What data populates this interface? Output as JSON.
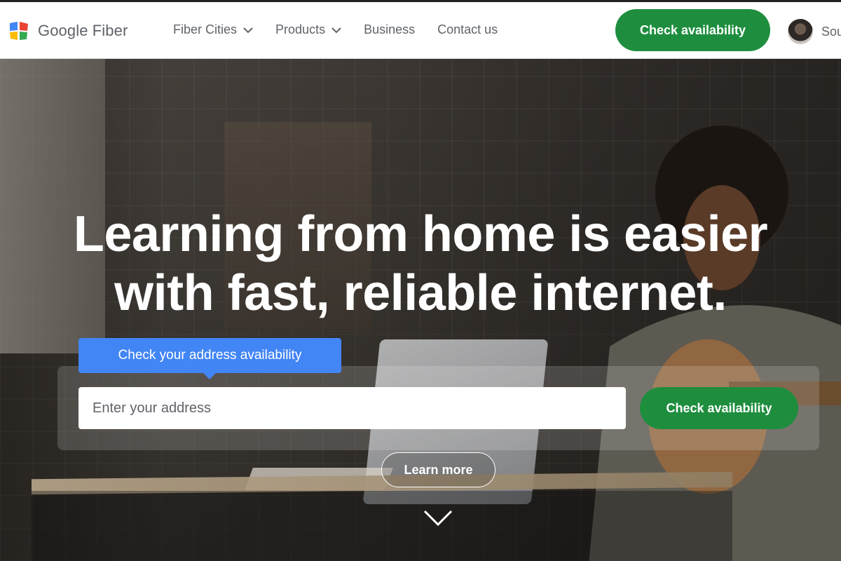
{
  "header": {
    "brand": "Google Fiber",
    "nav": [
      {
        "label": "Fiber Cities",
        "has_dropdown": true
      },
      {
        "label": "Products",
        "has_dropdown": true
      },
      {
        "label": "Business",
        "has_dropdown": false
      },
      {
        "label": "Contact us",
        "has_dropdown": false
      }
    ],
    "cta_label": "Check availability",
    "account_label": "Sou"
  },
  "hero": {
    "headline_line1": "Learning from home is easier",
    "headline_line2": "with fast, reliable internet.",
    "tooltip": "Check your address availability",
    "address_placeholder": "Enter your address",
    "address_value": "",
    "cta_label": "Check availability",
    "learn_more_label": "Learn more"
  },
  "icons": {
    "logo": "google-fiber-logo-icon",
    "dropdown": "chevron-down-icon",
    "scroll": "chevron-down-icon"
  },
  "colors": {
    "primary_green": "#1e8e3e",
    "tooltip_blue": "#4285f4",
    "nav_text": "#5f6368",
    "logo_blue": "#4285f4",
    "logo_red": "#ea4335",
    "logo_yellow": "#fbbc04",
    "logo_green": "#34a853"
  }
}
